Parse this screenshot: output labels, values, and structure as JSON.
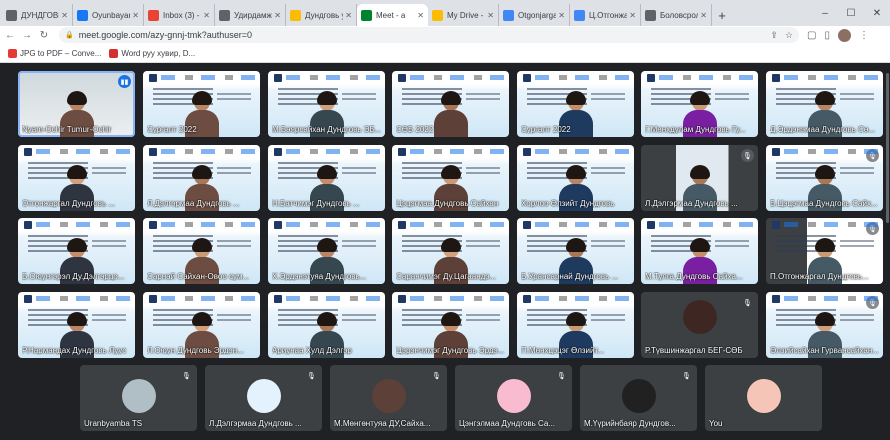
{
  "browser": {
    "tabs": [
      {
        "label": "ДУНДГОВЬ",
        "color": "#5f6368"
      },
      {
        "label": "Oyunbayar",
        "color": "#1877f2"
      },
      {
        "label": "Inbox (3) -",
        "color": "#ea4335"
      },
      {
        "label": "Удирдамж",
        "color": "#5f6368"
      },
      {
        "label": "Дундговь у",
        "color": "#fbbc04"
      },
      {
        "label": "Meet - a",
        "color": "#00832d",
        "active": true
      },
      {
        "label": "My Drive -",
        "color": "#fbbc04"
      },
      {
        "label": "Otgonjargal",
        "color": "#4285f4"
      },
      {
        "label": "Ц.Отгонжар",
        "color": "#4285f4"
      },
      {
        "label": "Боловсрол",
        "color": "#5f6368"
      }
    ],
    "new_tab": "+",
    "window_controls": [
      "–",
      "☐",
      "✕"
    ],
    "url": "meet.google.com/azy-gnnj-tmk?authuser=0",
    "bookmarks": [
      {
        "label": "JPG to PDF – Conve...",
        "color": "#e53935"
      },
      {
        "label": "Word руу хувир, D...",
        "color": "#d32f2f"
      }
    ]
  },
  "participants": [
    {
      "name": "Nyam-Ochir Tumur-Ochir",
      "type": "camera",
      "highlight": true,
      "speaking": true
    },
    {
      "name": "Сургалт 2022",
      "type": "slide"
    },
    {
      "name": "М.Баярсайхан Дундговь ЭБ...",
      "type": "slide"
    },
    {
      "name": "СӨБ 2022",
      "type": "slide"
    },
    {
      "name": "Сургалт 2022",
      "type": "slide"
    },
    {
      "name": "Г.Мөнхдулам Дундговь Гу...",
      "type": "slide"
    },
    {
      "name": "Д.Эрдэнэмаа Дундговь Сө...",
      "type": "slide"
    },
    {
      "name": "Отгонжаргал Дундговь ...",
      "type": "slide"
    },
    {
      "name": "Л.Дэлгэрмаа Дундговь ...",
      "type": "slide"
    },
    {
      "name": "Н.Батчимэг Дундговь ...",
      "type": "slide"
    },
    {
      "name": "Цэцэгмаа Дундговь Сайхан",
      "type": "slide"
    },
    {
      "name": "Хорлоо Өлзийт Дундговь",
      "type": "slide"
    },
    {
      "name": "Л.Дэлгэрмаа Дундговь ...",
      "type": "camera",
      "muted": true
    },
    {
      "name": "Б.Цэцэгмаа Дундговь Сайх...",
      "type": "slide",
      "muted": true
    },
    {
      "name": "Б.Оюунгэрэл Ду.Дэлгэрцо...",
      "type": "slide"
    },
    {
      "name": "Сарнай Сайхан-Овоо сум...",
      "type": "slide"
    },
    {
      "name": "Х.Эрдэнэтуяа Дундговь...",
      "type": "slide"
    },
    {
      "name": "Саранчимэг Ду.Цагаандэ...",
      "type": "slide"
    },
    {
      "name": "Б.Урансарнай Дундговь ...",
      "type": "slide"
    },
    {
      "name": "М.Тулга Дундговь Сайха...",
      "type": "slide"
    },
    {
      "name": "П.Отгонжаргал Дундговь...",
      "type": "blank-slide",
      "muted": true
    },
    {
      "name": "Р.Нармандах Дундговь Луус",
      "type": "slide"
    },
    {
      "name": "Л.Оюун Дундговь Эрдэн...",
      "type": "slide"
    },
    {
      "name": "Ариунаа Хулд Дэлгэр",
      "type": "slide"
    },
    {
      "name": "Цэрэнчимэг Дундговь Эрдэ...",
      "type": "slide"
    },
    {
      "name": "П.Мөнхцэцэг Өлзийт...",
      "type": "slide"
    },
    {
      "name": "Р.Түвшинжаргал БЕГ-СӨБ",
      "type": "avatar",
      "muted": true,
      "color": "#3e2723"
    },
    {
      "name": "Өлзийсайхан Гурвансайхан...",
      "type": "slide",
      "muted": true
    }
  ],
  "bottom_row": [
    {
      "name": "Uranbyamba TS",
      "color": "#b0bec5"
    },
    {
      "name": "Л.Дэлгэрмаа Дундговь ...",
      "color": "#e3f2fd"
    },
    {
      "name": "М.Мөнгөнтуяа ДУ,Сайха...",
      "color": "#5d4037"
    },
    {
      "name": "Цэнгэлмаа Дундговь Са...",
      "color": "#f8bbd0"
    },
    {
      "name": "М.Үүрийнбаяр Дундгов...",
      "color": "#212121"
    },
    {
      "name": "You",
      "color": "#f5c6b8"
    }
  ],
  "icons": {
    "muted": "mic-off-icon",
    "speaking": "speaking-icon"
  }
}
